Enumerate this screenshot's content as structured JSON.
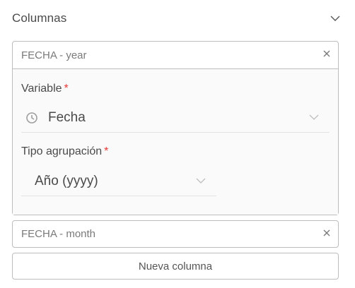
{
  "section": {
    "title": "Columnas",
    "chevron_icon": "chevron-down-icon"
  },
  "columns": [
    {
      "title": "FECHA - year",
      "expanded": true,
      "fields": {
        "variable": {
          "label": "Variable",
          "required_mark": "*",
          "value": "Fecha",
          "icon": "clock-icon"
        },
        "grouping": {
          "label": "Tipo agrupación",
          "required_mark": "*",
          "value": "Año (yyyy)"
        }
      }
    },
    {
      "title": "FECHA - month",
      "expanded": false
    }
  ],
  "actions": {
    "new_column_label": "Nueva columna"
  },
  "colors": {
    "required": "#e53935",
    "border": "#bdbdbd",
    "text": "#4a4a4a",
    "muted": "#7a7a7a"
  }
}
